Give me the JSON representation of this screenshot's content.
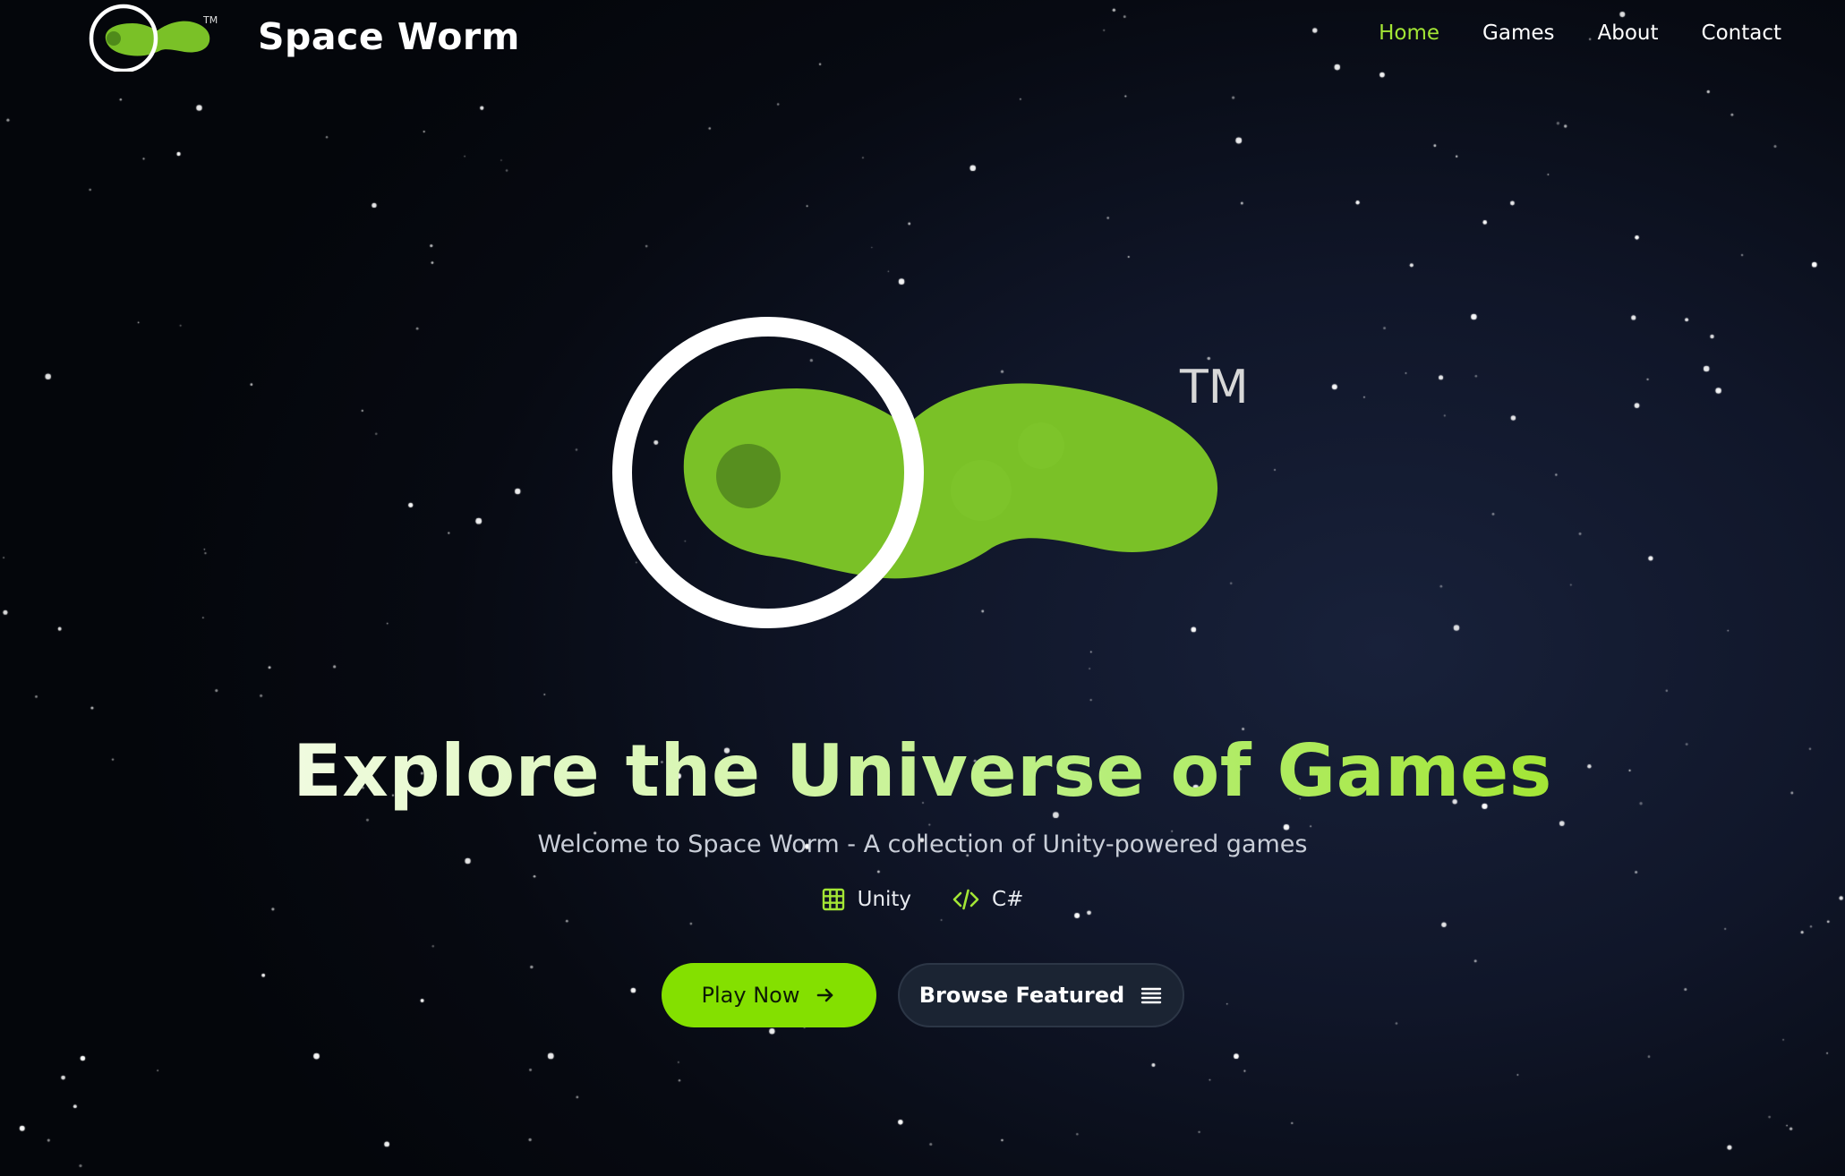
{
  "brand": {
    "name": "Space Worm",
    "logo_icon": "space-worm-logo-icon",
    "trademark": "TM"
  },
  "nav": {
    "items": [
      {
        "label": "Home",
        "active": true
      },
      {
        "label": "Games",
        "active": false
      },
      {
        "label": "About",
        "active": false
      },
      {
        "label": "Contact",
        "active": false
      }
    ]
  },
  "hero": {
    "logo_icon": "space-worm-logo-icon",
    "trademark": "TM",
    "title": "Explore the Universe of Games",
    "subtitle": "Welcome to Space Worm - A collection of Unity-powered games",
    "tags": [
      {
        "label": "Unity",
        "icon": "grid-icon"
      },
      {
        "label": "C#",
        "icon": "code-icon"
      }
    ],
    "primary_button": {
      "label": "Play Now",
      "icon": "arrow-right-icon"
    },
    "secondary_button": {
      "label": "Browse Featured",
      "icon": "list-icon"
    }
  },
  "colors": {
    "accent": "#a3e635",
    "button_primary": "#84e000",
    "button_secondary": "#1b2433",
    "worm_green": "#7ac127",
    "background": "#0b0f1c"
  }
}
